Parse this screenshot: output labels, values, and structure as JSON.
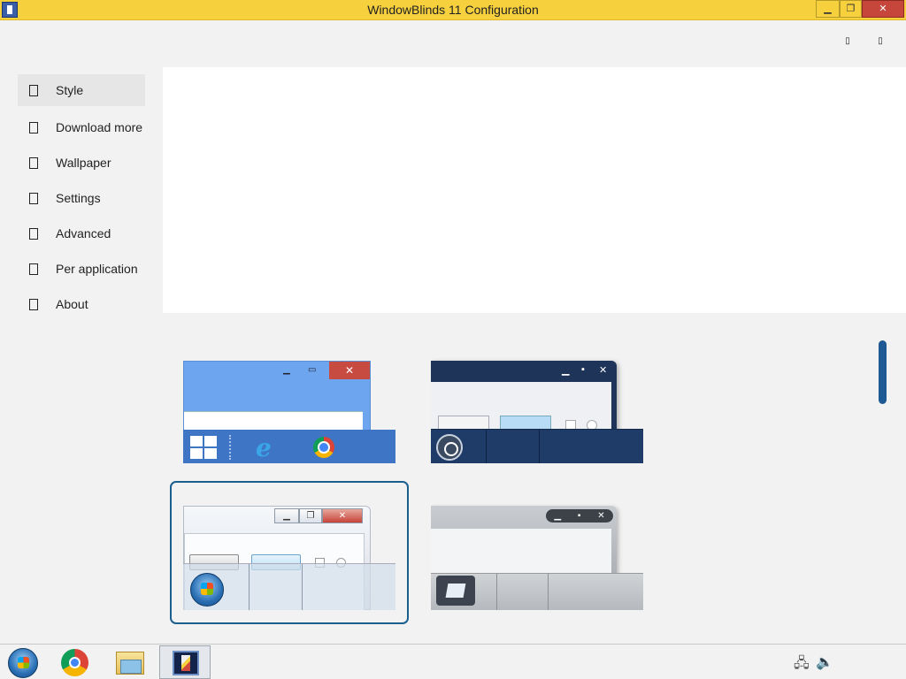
{
  "window": {
    "title": "WindowBlinds 11 Configuration",
    "minimize": "▁",
    "maximize": "❐",
    "close": "✕"
  },
  "header_buttons": [
    "▯",
    "▯"
  ],
  "sidebar": {
    "items": [
      {
        "label": "Style",
        "active": true
      },
      {
        "label": "Download more"
      },
      {
        "label": "Wallpaper"
      },
      {
        "label": "Settings"
      },
      {
        "label": "Advanced"
      },
      {
        "label": "Per application"
      },
      {
        "label": "About"
      }
    ]
  },
  "themes": [
    {
      "name": "windows-8-theme",
      "selected": false,
      "min": "▁",
      "max": "▭",
      "close": "✕"
    },
    {
      "name": "dark-blue-theme",
      "selected": false,
      "min": "▁",
      "max": "▪",
      "close": "✕"
    },
    {
      "name": "windows-7-theme",
      "selected": true,
      "min": "▁",
      "max": "❐",
      "close": "✕"
    },
    {
      "name": "grey-theme",
      "selected": false,
      "min": "▁",
      "max": "▪",
      "close": "✕"
    }
  ],
  "taskbar": {
    "items": [
      "start-button",
      "chrome",
      "file-explorer",
      "windowblinds"
    ]
  },
  "colors": {
    "titlebar": "#f7d13d",
    "selection_border": "#1b5f8f",
    "scrollbar": "#1d5a94"
  }
}
